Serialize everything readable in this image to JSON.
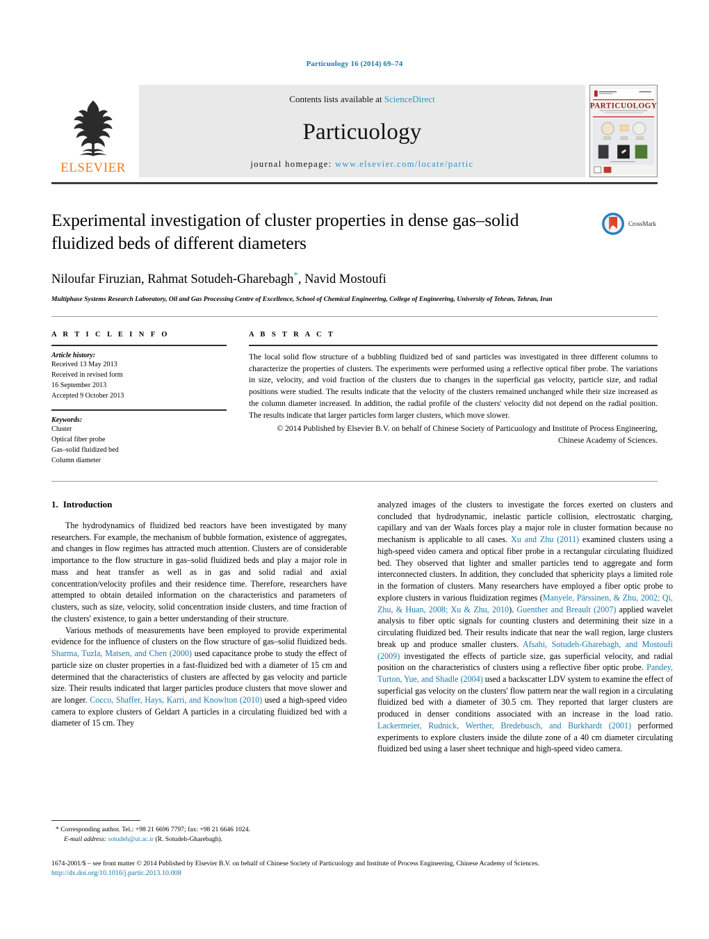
{
  "running_head": "Particuology 16 (2014) 69–74",
  "masthead": {
    "contents_prefix": "Contents lists available at ",
    "sciencedirect": "ScienceDirect",
    "journal_title": "Particuology",
    "homepage_prefix": "journal homepage:",
    "homepage_url": "www.elsevier.com/locate/partic",
    "publisher": "ELSEVIER",
    "cover_title": "PARTICUOLOGY"
  },
  "article": {
    "title": "Experimental investigation of cluster properties in dense gas–solid fluidized beds of different diameters",
    "crossmark_label": "CrossMark",
    "authors": "Niloufar Firuzian, Rahmat Sotudeh-Gharebagh",
    "authors_tail": ", Navid Mostoufi",
    "affiliation": "Multiphase Systems Research Laboratory, Oil and Gas Processing Centre of Excellence, School of Chemical Engineering, College of Engineering, University of Tehran, Tehran, Iran"
  },
  "article_info": {
    "heading": "A R T I C L E   I N F O",
    "history_label": "Article history:",
    "history": [
      "Received 13 May 2013",
      "Received in revised form",
      "16 September 2013",
      "Accepted 9 October 2013"
    ],
    "keywords_label": "Keywords:",
    "keywords": [
      "Cluster",
      "Optical fiber probe",
      "Gas–solid fluidized bed",
      "Column diameter"
    ]
  },
  "abstract": {
    "heading": "A B S T R A C T",
    "text": "The local solid flow structure of a bubbling fluidized bed of sand particles was investigated in three different columns to characterize the properties of clusters. The experiments were performed using a reflective optical fiber probe. The variations in size, velocity, and void fraction of the clusters due to changes in the superficial gas velocity, particle size, and radial positions were studied. The results indicate that the velocity of the clusters remained unchanged while their size increased as the column diameter increased. In addition, the radial profile of the clusters' velocity did not depend on the radial position. The results indicate that larger particles form larger clusters, which move slower.",
    "copyright": "© 2014 Published by Elsevier B.V. on behalf of Chinese Society of Particuology and Institute of Process Engineering, Chinese Academy of Sciences."
  },
  "introduction": {
    "number": "1.",
    "heading": "Introduction",
    "left_paragraphs": [
      {
        "segments": [
          {
            "text": "The hydrodynamics of fluidized bed reactors have been investigated by many researchers. For example, the mechanism of bubble formation, existence of aggregates, and changes in flow regimes has attracted much attention. Clusters are of considerable importance to the flow structure in gas–solid fluidized beds and play a major role in mass and heat transfer as well as in gas and solid radial and axial concentration/velocity profiles and their residence time. Therefore, researchers have attempted to obtain detailed information on the characteristics and parameters of clusters, such as size, velocity, solid concentration inside clusters, and time fraction of the clusters' existence, to gain a better understanding of their structure.",
            "cite": false
          }
        ]
      },
      {
        "segments": [
          {
            "text": "Various methods of measurements have been employed to provide experimental evidence for the influence of clusters on the flow structure of gas–solid fluidized beds. ",
            "cite": false
          },
          {
            "text": "Sharma, Tuzla, Matsen, and Chen (2000)",
            "cite": true
          },
          {
            "text": " used capacitance probe to study the effect of particle size on cluster properties in a fast-fluidized bed with a diameter of 15 cm and determined that the characteristics of clusters are affected by gas velocity and particle size. Their results indicated that larger particles produce clusters that move slower and are longer. ",
            "cite": false
          },
          {
            "text": "Cocco, Shaffer, Hays, Karri, and Knowlton (2010)",
            "cite": true
          },
          {
            "text": " used a high-speed video camera to explore clusters of Geldart A particles in a circulating fluidized bed with a diameter of 15 cm. They",
            "cite": false
          }
        ]
      }
    ],
    "right_paragraphs": [
      {
        "segments": [
          {
            "text": "analyzed images of the clusters to investigate the forces exerted on clusters and concluded that hydrodynamic, inelastic particle collision, electrostatic charging, capillary and van der Waals forces play a major role in cluster formation because no mechanism is applicable to all cases. ",
            "cite": false
          },
          {
            "text": "Xu and Zhu (2011)",
            "cite": true
          },
          {
            "text": " examined clusters using a high-speed video camera and optical fiber probe in a rectangular circulating fluidized bed. They observed that lighter and smaller particles tend to aggregate and form interconnected clusters. In addition, they concluded that sphericity plays a limited role in the formation of clusters. Many researchers have employed a fiber optic probe to explore clusters in various fluidization regimes (",
            "cite": false
          },
          {
            "text": "Manyele, Pärssinen, & Zhu, 2002; Qi, Zhu, & Huan, 2008; Xu & Zhu, 2010",
            "cite": true
          },
          {
            "text": "). ",
            "cite": false
          },
          {
            "text": "Guenther and Breault (2007)",
            "cite": true
          },
          {
            "text": " applied wavelet analysis to fiber optic signals for counting clusters and determining their size in a circulating fluidized bed. Their results indicate that near the wall region, large clusters break up and produce smaller clusters. ",
            "cite": false
          },
          {
            "text": "Afsahi, Sotudeh-Gharebagh, and Mostoufi (2009)",
            "cite": true
          },
          {
            "text": " investigated the effects of particle size, gas superficial velocity, and radial position on the characteristics of clusters using a reflective fiber optic probe. ",
            "cite": false
          },
          {
            "text": "Pandey, Turton, Yue, and Shadle (2004)",
            "cite": true
          },
          {
            "text": " used a backscatter LDV system to examine the effect of superficial gas velocity on the clusters' flow pattern near the wall region in a circulating fluidized bed with a diameter of 30.5 cm. They reported that larger clusters are produced in denser conditions associated with an increase in the load ratio. ",
            "cite": false
          },
          {
            "text": "Lackermeier, Rudnick, Werther, Bredebusch, and Burkhardt (2001)",
            "cite": true
          },
          {
            "text": " performed experiments to explore clusters inside the dilute zone of a 40 cm diameter circulating fluidized bed using a laser sheet technique and high-speed video camera.",
            "cite": false
          }
        ]
      }
    ]
  },
  "footnote": {
    "marker": "*",
    "line1": "Corresponding author. Tel.: +98 21 6696 7797; fax: +98 21 6646 1024.",
    "email_label": "E-mail address:",
    "email": "sotudeh@ut.ac.ir",
    "email_owner": "(R. Sotudeh-Gharebagh)."
  },
  "footer": {
    "copyright": "1674-2001/$ – see front matter © 2014 Published by Elsevier B.V. on behalf of Chinese Society of Particuology and Institute of Process Engineering, Chinese Academy of Sciences.",
    "doi": "http://dx.doi.org/10.1016/j.partic.2013.10.008"
  },
  "colors": {
    "link": "#1a7aa8",
    "sciencedirect": "#2196c4",
    "elsevier_orange": "#ef7d22",
    "band_gray": "#e9e9e9"
  }
}
